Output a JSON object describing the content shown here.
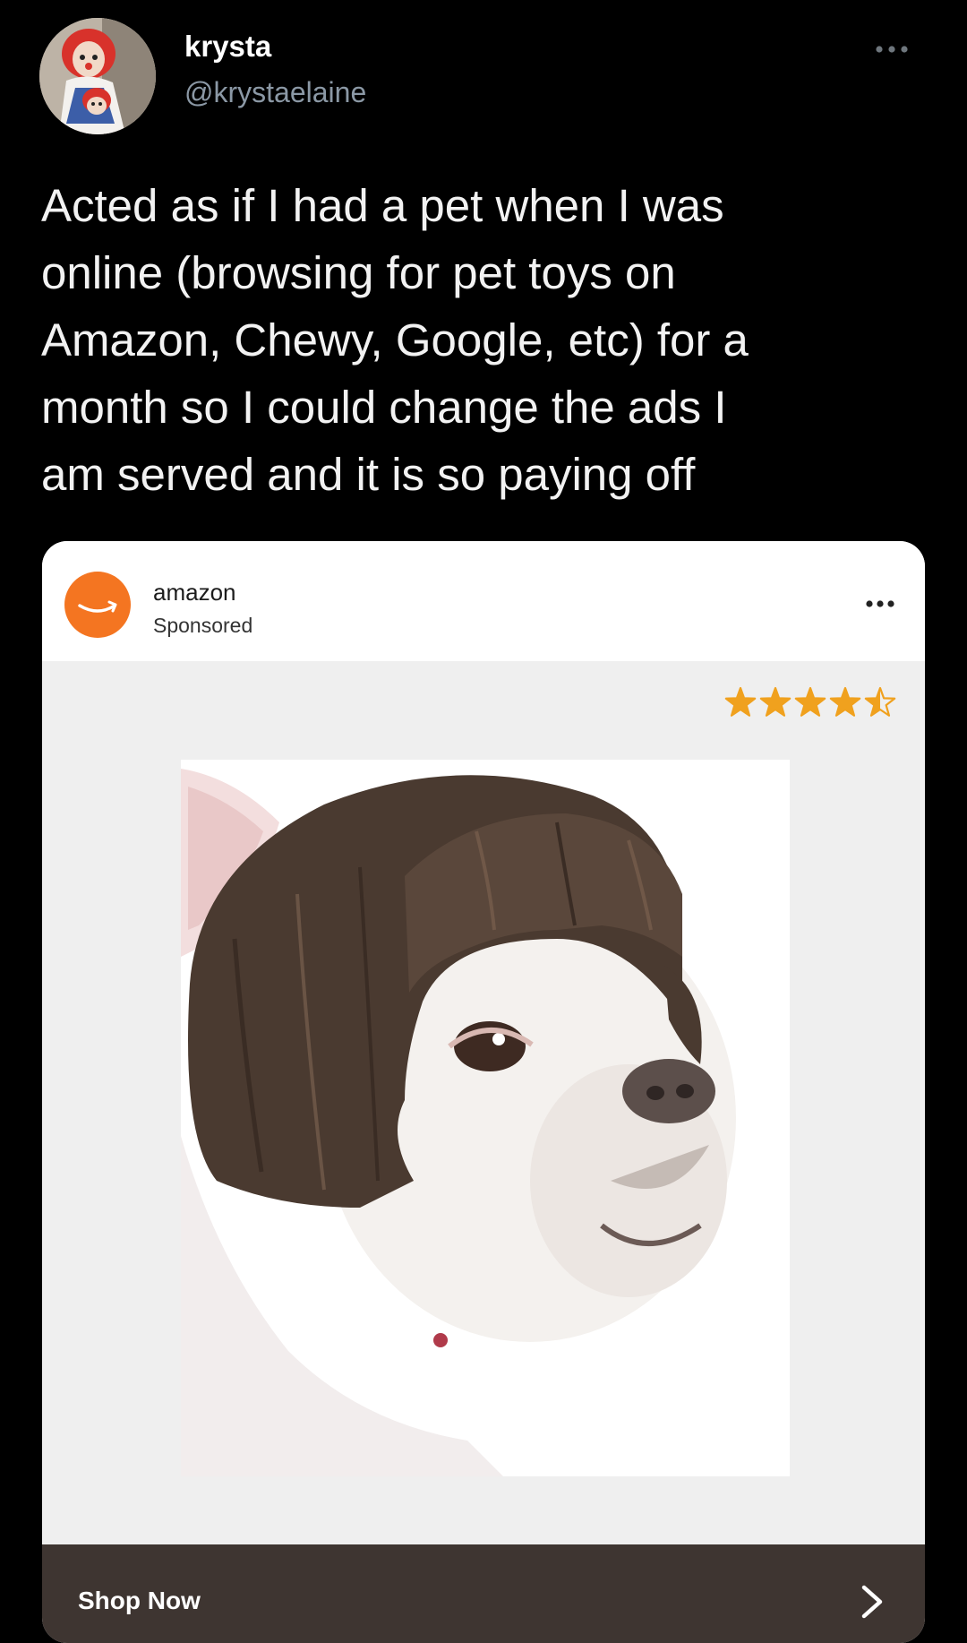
{
  "tweet": {
    "display_name": "krysta",
    "handle": "@krystaelaine",
    "text": "Acted as if I had a pet when I was\nonline (browsing for pet toys on\nAmazon, Chewy, Google, etc) for a\nmonth so I could change the ads I\nam served and it is so paying off",
    "more_icon": "more-horizontal-icon"
  },
  "ad": {
    "brand": "amazon",
    "sponsored_label": "Sponsored",
    "logo_icon": "amazon-smile-logo",
    "logo_color": "#f47521",
    "more_icon": "more-horizontal-icon",
    "rating": 4.5,
    "rating_max": 5,
    "star_color": "#f0a11e",
    "cta_label": "Shop Now",
    "cta_icon": "chevron-right-icon",
    "cta_bar_color": "#3e3531"
  }
}
